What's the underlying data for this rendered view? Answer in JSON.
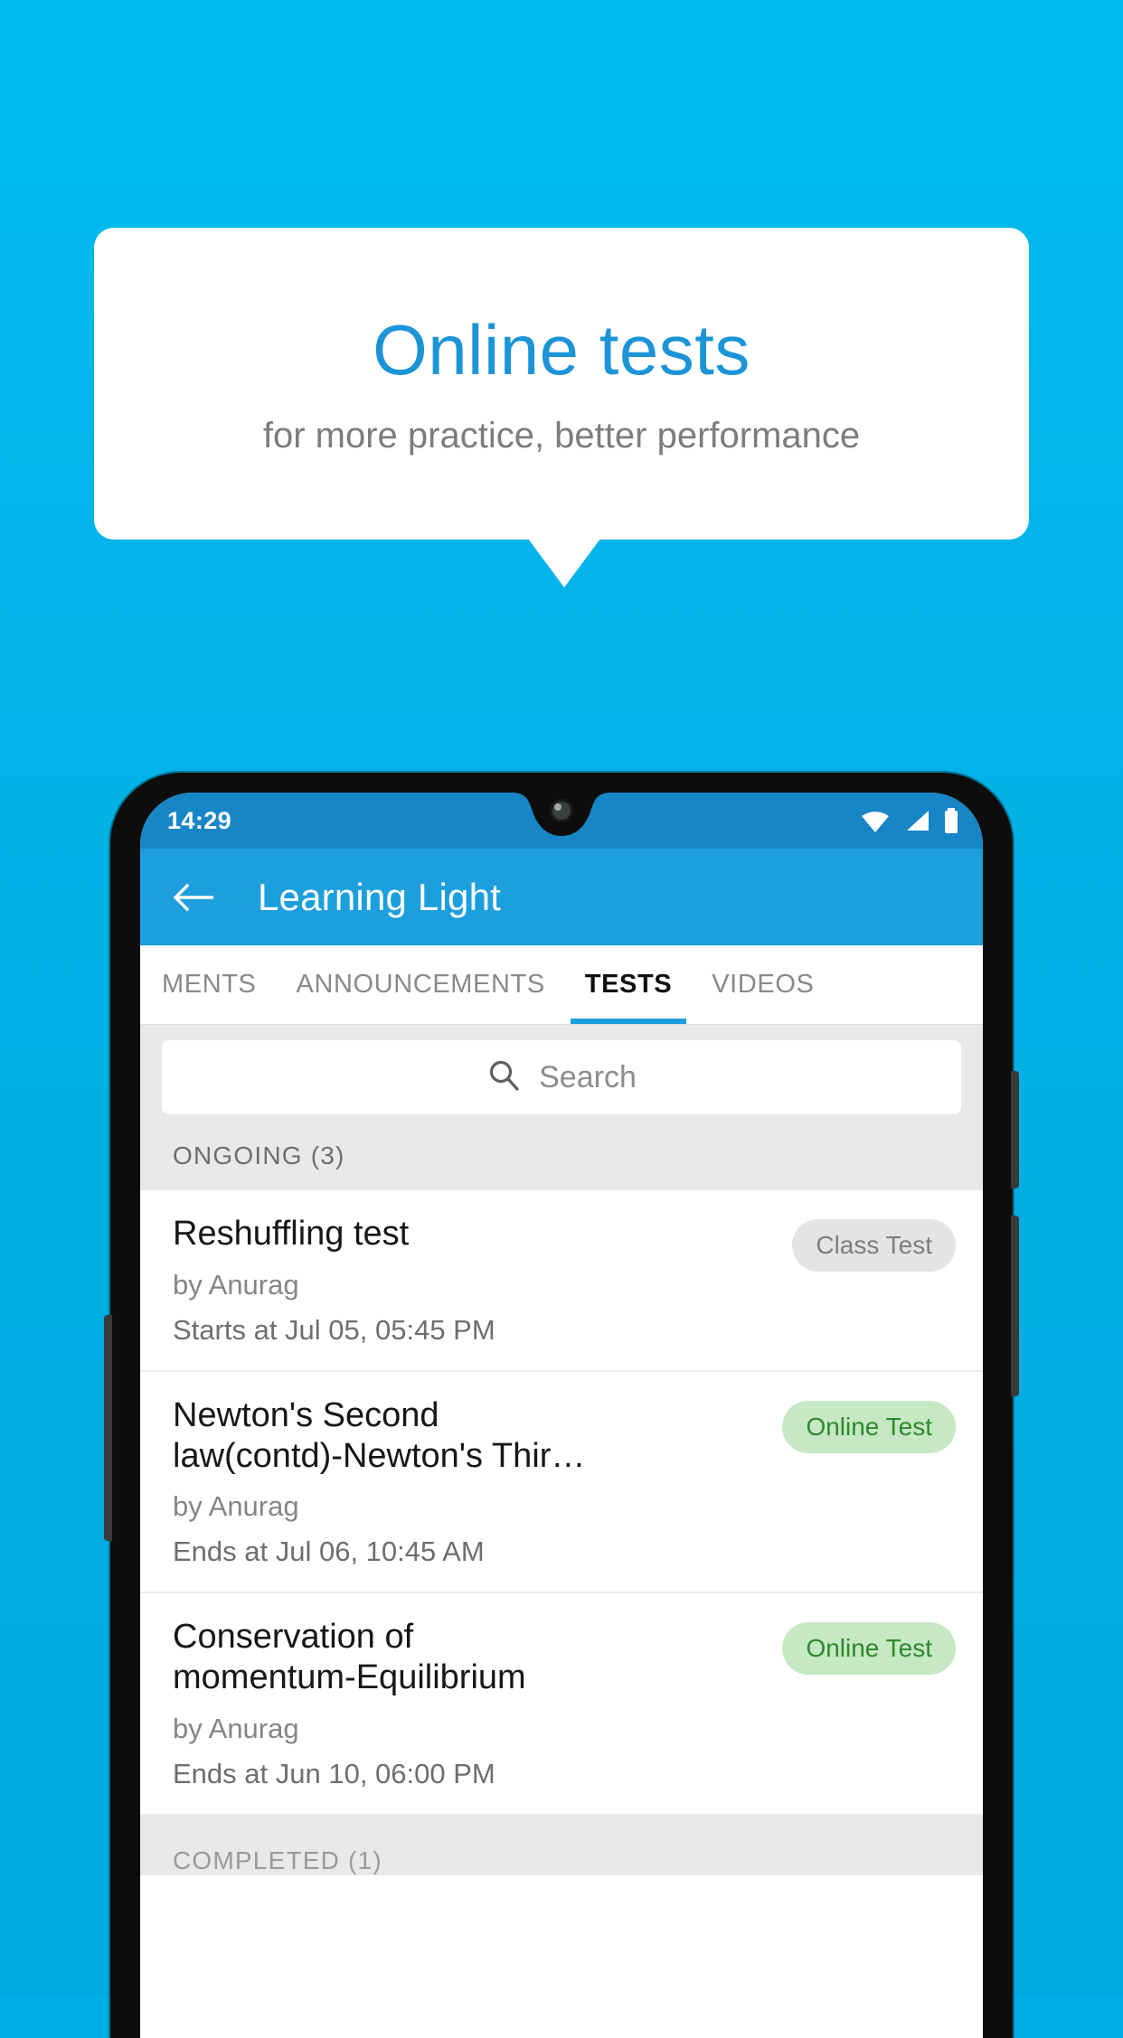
{
  "promo": {
    "title": "Online tests",
    "subtitle": "for more practice, better performance"
  },
  "phone": {
    "status_bar": {
      "time": "14:29",
      "icons": [
        "wifi-icon",
        "signal-icon",
        "battery-icon"
      ]
    },
    "app_bar": {
      "back_icon": "back-arrow-icon",
      "title": "Learning Light"
    },
    "tabs": [
      {
        "label": "MENTS",
        "active": false
      },
      {
        "label": "ANNOUNCEMENTS",
        "active": false
      },
      {
        "label": "TESTS",
        "active": true
      },
      {
        "label": "VIDEOS",
        "active": false
      }
    ],
    "search": {
      "icon": "search-icon",
      "placeholder": "Search",
      "value": ""
    },
    "sections": [
      {
        "label": "ONGOING (3)"
      },
      {
        "label": "COMPLETED (1)"
      }
    ],
    "tests": [
      {
        "title": "Reshuffling test",
        "author": "by Anurag",
        "time": "Starts at  Jul 05, 05:45 PM",
        "badge": "Class Test",
        "badge_style": "gray"
      },
      {
        "title": "Newton's Second law(contd)-Newton's Thir…",
        "author": "by Anurag",
        "time": "Ends at  Jul 06, 10:45 AM",
        "badge": "Online Test",
        "badge_style": "green"
      },
      {
        "title": "Conservation of momentum-Equilibrium",
        "author": "by Anurag",
        "time": "Ends at  Jun 10, 06:00 PM",
        "badge": "Online Test",
        "badge_style": "green"
      }
    ]
  },
  "colors": {
    "background": "#01AEE6",
    "brand_blue": "#1C9FDC",
    "status_bar_blue": "#1786C6",
    "title_blue": "#1C94D8",
    "badge_green_bg": "#C6E8C4",
    "badge_green_text": "#2C8A2C",
    "badge_gray_bg": "#E4E4E4",
    "badge_gray_text": "#7E7E7E"
  }
}
